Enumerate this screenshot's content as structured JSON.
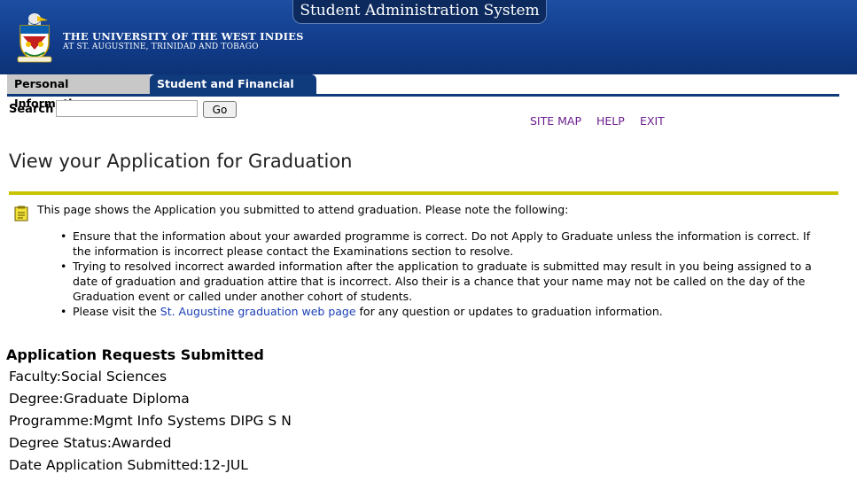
{
  "banner": {
    "system_title": "Student Administration System",
    "university_name": "THE UNIVERSITY OF THE WEST INDIES",
    "location": "AT ST. AUGUSTINE, TRINIDAD AND TOBAGO",
    "brand_color": "#123d8c"
  },
  "nav": {
    "tabs": [
      {
        "label": "Personal Information",
        "active": false
      },
      {
        "label": "Student and Financial Aid",
        "active": true
      }
    ]
  },
  "search": {
    "label": "Search",
    "value": "",
    "go_label": "Go"
  },
  "toplinks": {
    "site_map": "SITE MAP",
    "help": "HELP",
    "exit": "EXIT"
  },
  "page": {
    "title": "View your Application for Graduation",
    "rule_color": "#c9c400"
  },
  "info": {
    "icon": "note-icon",
    "intro": "This page shows the Application you submitted to attend graduation. Please note the following:",
    "bullet1": "Ensure that the information about your awarded programme is correct. Do not Apply to Graduate unless the information is correct. If the information is incorrect please contact the Examinations section to resolve.",
    "bullet2": "Trying to resolved incorrect awarded information after the application to graduate is submitted may result in you being assigned to a date of graduation and graduation attire that is incorrect. Also their is a chance that your name may not be called on the day of the Graduation event or called under another cohort of students.",
    "bullet3_pre": "Please visit the ",
    "bullet3_link": "St. Augustine graduation web page",
    "bullet3_post": " for any question or updates to graduation information."
  },
  "requests": {
    "heading": "Application Requests Submitted",
    "faculty_label": "Faculty:",
    "faculty": "Social Sciences",
    "degree_label": "Degree:",
    "degree": "Graduate Diploma",
    "programme_label": "Programme:",
    "programme": "Mgmt Info Systems DIPG S N",
    "status_label": "Degree Status:",
    "status": "Awarded",
    "date_label": "Date Application Submitted:",
    "date": "12-JUL"
  }
}
